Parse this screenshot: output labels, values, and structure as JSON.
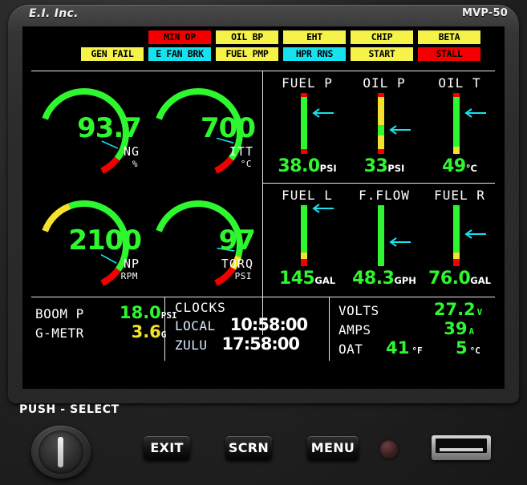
{
  "device": {
    "brand": "E.I. Inc.",
    "model": "MVP-50",
    "push_select_label": "PUSH - SELECT"
  },
  "colors": {
    "green": "#2ff72f",
    "yellow": "#f5e22a",
    "red": "#f20000",
    "cyan": "#16e2ef",
    "white": "#ffffff",
    "annun_yellow": "#f5f24a",
    "annun_cyan": "#16e2ef",
    "annun_red": "#f20000"
  },
  "annunciators": {
    "row1": [
      {
        "label": "MIN OP",
        "state": "red"
      },
      {
        "label": "OIL BP",
        "state": "yellow"
      },
      {
        "label": "EHT",
        "state": "yellow"
      },
      {
        "label": "CHIP",
        "state": "yellow"
      },
      {
        "label": "BETA",
        "state": "yellow"
      }
    ],
    "row2": [
      {
        "label": "GEN FAIL",
        "state": "yellow"
      },
      {
        "label": "E FAN BRK",
        "state": "cyan"
      },
      {
        "label": "FUEL PMP",
        "state": "yellow"
      },
      {
        "label": "HPR RNS",
        "state": "cyan"
      },
      {
        "label": "START",
        "state": "yellow"
      },
      {
        "label": "STALL",
        "state": "red"
      }
    ]
  },
  "dials": [
    {
      "name": "NG",
      "value": "93.7",
      "unit": "%",
      "needle_pct": 0.82,
      "green_end": 0.88,
      "yellow_start": null,
      "yellow_end": null,
      "red_start": 0.88
    },
    {
      "name": "ITT",
      "value": "700",
      "unit": "°C",
      "needle_pct": 0.78,
      "green_end": 0.86,
      "yellow_start": null,
      "yellow_end": null,
      "red_start": 0.88
    },
    {
      "name": "NP",
      "value": "2100",
      "unit": "RPM",
      "needle_pct": 0.84,
      "green_end": 0.87,
      "yellow_start": 0.0,
      "yellow_end": 0.22,
      "red_start": 0.87
    },
    {
      "name": "TORQ",
      "value": "97",
      "unit": "PSI",
      "needle_pct": 0.75,
      "green_end": 0.78,
      "yellow_start": 0.78,
      "yellow_end": 0.86,
      "red_start": 0.86
    }
  ],
  "bars": [
    {
      "name": "FUEL P",
      "value": "38.0",
      "unit": "PSI",
      "pointer_pct": 0.33,
      "segments": [
        {
          "color": "red",
          "from": 0.0,
          "to": 0.07
        },
        {
          "color": "green",
          "from": 0.07,
          "to": 0.92
        },
        {
          "color": "red",
          "from": 0.92,
          "to": 1.0
        }
      ]
    },
    {
      "name": "OIL P",
      "value": "33",
      "unit": "PSI",
      "pointer_pct": 0.6,
      "segments": [
        {
          "color": "red",
          "from": 0.0,
          "to": 0.07
        },
        {
          "color": "yellow",
          "from": 0.07,
          "to": 0.52
        },
        {
          "color": "green",
          "from": 0.52,
          "to": 0.7
        },
        {
          "color": "yellow",
          "from": 0.7,
          "to": 0.92
        },
        {
          "color": "red",
          "from": 0.92,
          "to": 1.0
        }
      ]
    },
    {
      "name": "OIL T",
      "value": "49",
      "unit": "°C",
      "pointer_pct": 0.33,
      "segments": [
        {
          "color": "red",
          "from": 0.0,
          "to": 0.07
        },
        {
          "color": "green",
          "from": 0.07,
          "to": 0.88
        },
        {
          "color": "yellow",
          "from": 0.88,
          "to": 1.0
        }
      ]
    },
    {
      "name": "FUEL L",
      "value": "145",
      "unit": "GAL",
      "pointer_pct": 0.05,
      "segments": [
        {
          "color": "green",
          "from": 0.0,
          "to": 0.78
        },
        {
          "color": "yellow",
          "from": 0.78,
          "to": 0.88
        },
        {
          "color": "red",
          "from": 0.88,
          "to": 1.0
        }
      ]
    },
    {
      "name": "F.FLOW",
      "value": "48.3",
      "unit": "GPH",
      "pointer_pct": 0.6,
      "segments": [
        {
          "color": "green",
          "from": 0.0,
          "to": 1.0
        }
      ]
    },
    {
      "name": "FUEL R",
      "value": "76.0",
      "unit": "GAL",
      "pointer_pct": 0.48,
      "segments": [
        {
          "color": "green",
          "from": 0.0,
          "to": 0.78
        },
        {
          "color": "yellow",
          "from": 0.78,
          "to": 0.88
        },
        {
          "color": "red",
          "from": 0.88,
          "to": 1.0
        }
      ]
    }
  ],
  "left_block": {
    "rows": [
      {
        "name": "BOOM P",
        "value": "18.0",
        "unit": "PSI",
        "value_color": "g"
      },
      {
        "name": "G-METR",
        "value": "3.6",
        "unit": "G",
        "value_color": "y"
      }
    ]
  },
  "clocks": {
    "title": "CLOCKS",
    "rows": [
      {
        "name": "LOCAL",
        "value": "10:58:00"
      },
      {
        "name": "ZULU",
        "value": "17:58:00"
      }
    ]
  },
  "right_block": {
    "rows": [
      {
        "name": "VOLTS",
        "value": "27.2",
        "unit": "V"
      },
      {
        "name": "AMPS",
        "value": "39",
        "unit": "A"
      },
      {
        "name": "OAT",
        "value": "41",
        "unit": "°F",
        "value2": "5",
        "unit2": "°C"
      }
    ]
  },
  "buttons": {
    "exit": "EXIT",
    "scrn": "SCRN",
    "menu": "MENU"
  }
}
